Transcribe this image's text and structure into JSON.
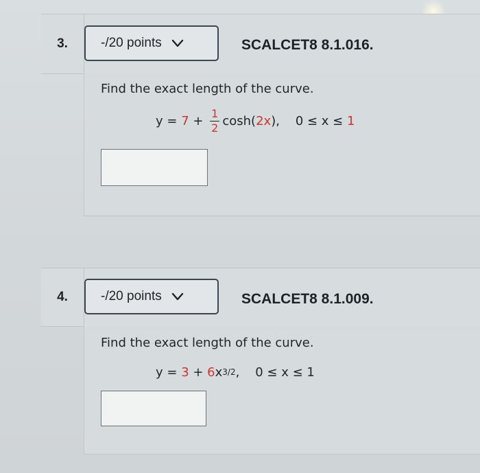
{
  "questions": [
    {
      "number": "3.",
      "points_label": "-/20 points",
      "source": "SCALCET8 8.1.016.",
      "prompt": "Find the exact length of the curve.",
      "equation": {
        "lhs": "y = ",
        "const": "7",
        "plus": " + ",
        "frac_num": "1",
        "frac_den": "2",
        "func": "cosh(",
        "arg": "2x",
        "close": "),",
        "range_prefix": "    0 ≤ x ≤ ",
        "range_end": "1"
      },
      "answer_value": ""
    },
    {
      "number": "4.",
      "points_label": "-/20 points",
      "source": "SCALCET8 8.1.009.",
      "prompt": "Find the exact length of the curve.",
      "equation": {
        "lhs": "y = ",
        "const": "3",
        "plus": " + ",
        "coef": "6",
        "var": "x",
        "exponent": "3/2",
        "comma": ",",
        "range_prefix": "    0 ≤ x ≤ ",
        "range_end": "1"
      },
      "answer_value": ""
    }
  ],
  "icons": {
    "points_dropdown": "chevron-down-icon"
  },
  "colors": {
    "accent_red": "#d2342c",
    "button_border": "#3c4650"
  }
}
